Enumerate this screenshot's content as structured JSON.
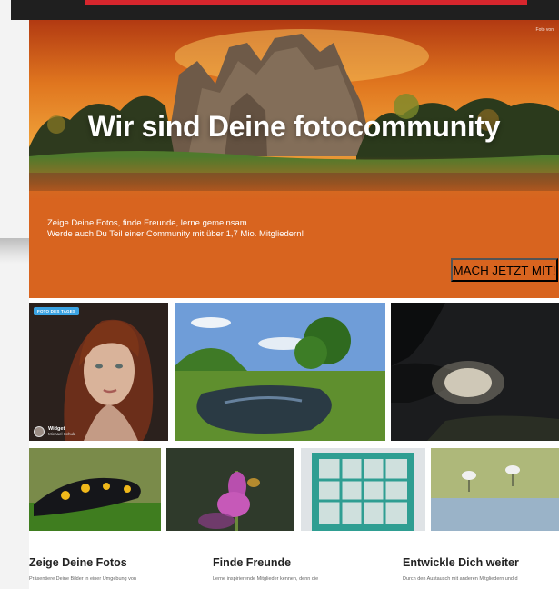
{
  "hero": {
    "corner_link": "Foto von",
    "headline": "Wir sind Deine fotocommunity",
    "sub_line1": "Zeige Deine Fotos, finde Freunde, lerne gemeinsam.",
    "sub_line2": "Werde auch Du Teil einer Community mit über 1,7 Mio. Mitgliedern!",
    "cta_label": "MACH JETZT MIT!"
  },
  "photos": [
    {
      "badge": "FOTO DES TAGES",
      "title": "Widget",
      "author": "Michael Schulz"
    }
  ],
  "features": [
    {
      "title": "Zeige Deine Fotos",
      "text": "Präsentiere Deine Bilder in einer Umgebung von"
    },
    {
      "title": "Finde Freunde",
      "text": "Lerne inspirierende Mitglieder kennen, denn die"
    },
    {
      "title": "Entwickle Dich weiter",
      "text": "Durch den Austausch mit anderen Mitgliedern und d"
    }
  ],
  "colors": {
    "accent": "#d8641f",
    "topbar": "#1f1f1f",
    "topbar_accent": "#d7262d",
    "badge": "#3aa3e3"
  }
}
